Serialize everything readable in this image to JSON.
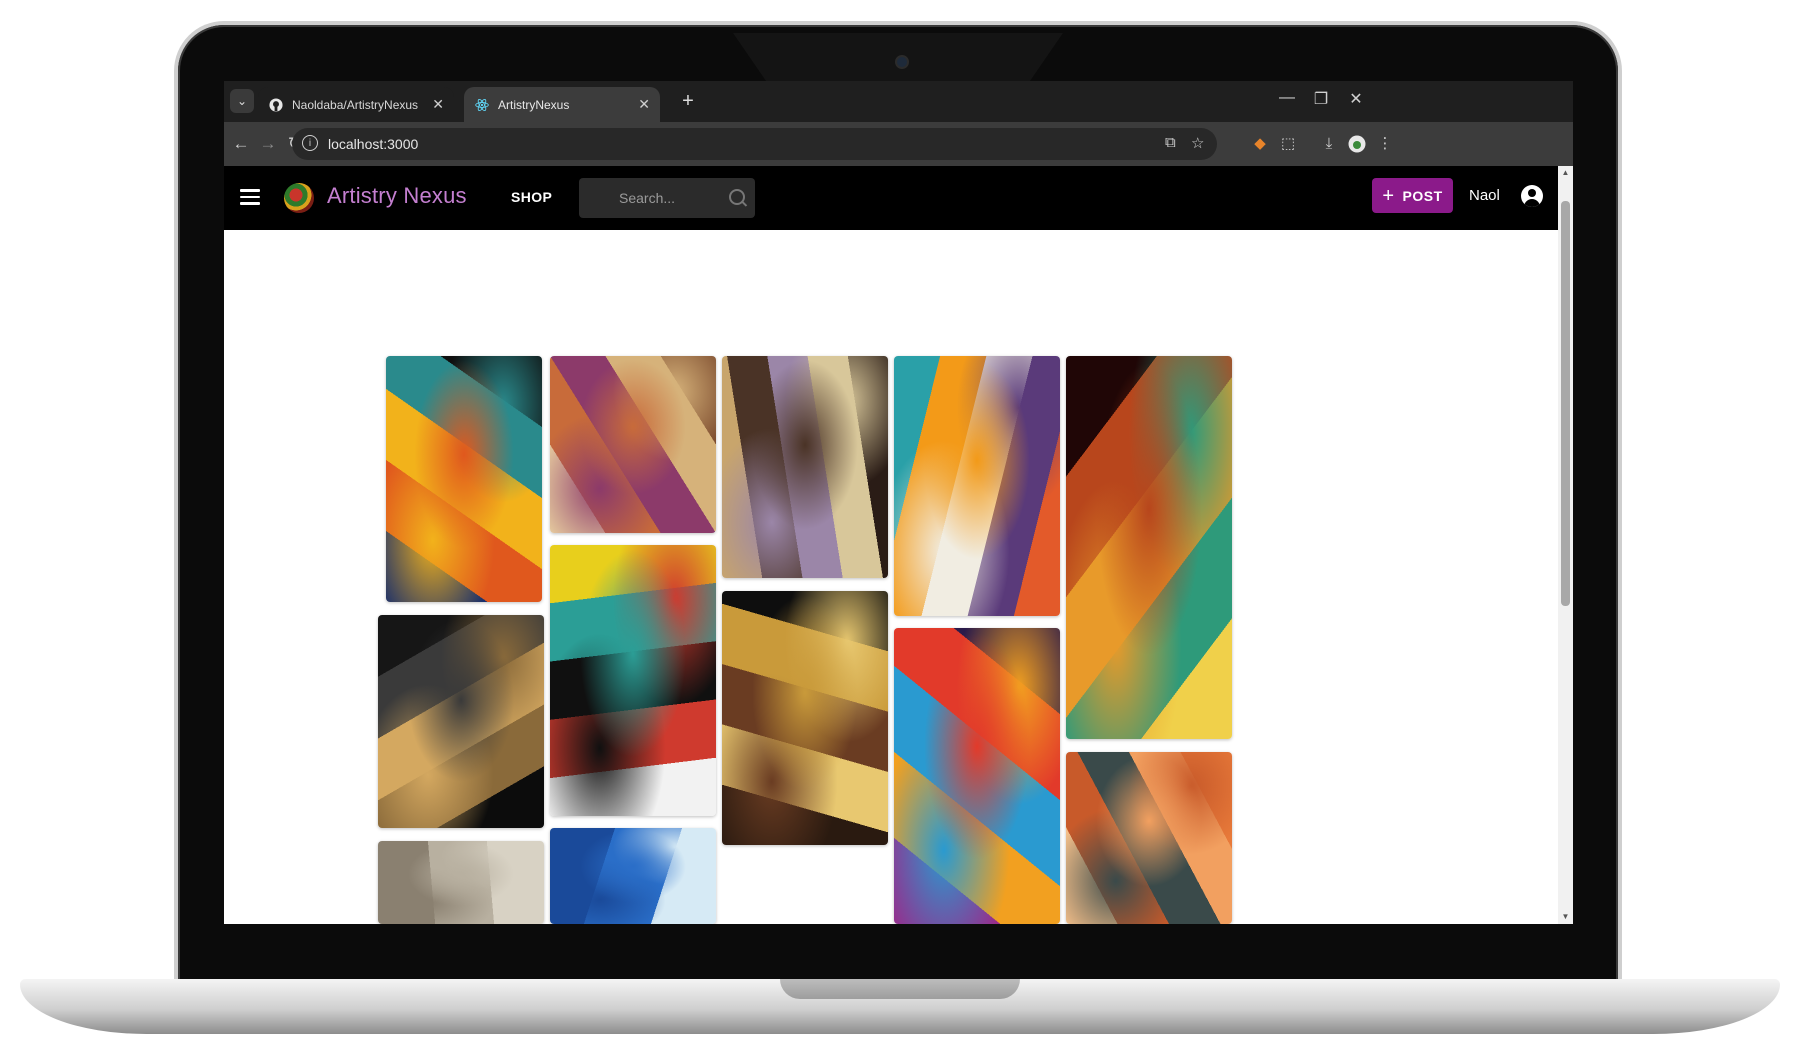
{
  "browser": {
    "tabs": [
      {
        "title": "Naoldaba/ArtistryNexus",
        "favicon": "github-icon",
        "active": false
      },
      {
        "title": "ArtistryNexus",
        "favicon": "react-icon",
        "active": true
      }
    ],
    "url": "localhost:3000"
  },
  "app": {
    "brand": "Artistry Nexus",
    "nav_shop": "SHOP",
    "search_placeholder": "Search...",
    "post_label": "POST",
    "user_name": "Naol",
    "accent_color": "#8b1a8a",
    "brand_color": "#c47fd0"
  },
  "gallery": [
    {
      "name": "abstract-faces-artwork",
      "colors": [
        "#1a2f6b",
        "#e0581d",
        "#f2b21b",
        "#2a8a8c",
        "#0f0f0f"
      ]
    },
    {
      "name": "musicians-painting",
      "colors": [
        "#e9cfa0",
        "#c86b3a",
        "#8c3a6a",
        "#d6b27a",
        "#7b4a2d"
      ]
    },
    {
      "name": "flower-crown-portrait",
      "colors": [
        "#c8a56c",
        "#4a3326",
        "#9b86a8",
        "#d8c79a",
        "#2a1c16"
      ]
    },
    {
      "name": "cubist-eye-face",
      "colors": [
        "#2aa0a8",
        "#f39a18",
        "#f1ede2",
        "#5a3a7a",
        "#e35a2a"
      ]
    },
    {
      "name": "tribal-mask",
      "colors": [
        "#200606",
        "#b8461c",
        "#e89a2a",
        "#2e9a7a",
        "#f0d04a"
      ]
    },
    {
      "name": "golden-fish-woodcut",
      "colors": [
        "#161616",
        "#3a3a3a",
        "#d4a860",
        "#8a6a3a",
        "#0c0c0c"
      ]
    },
    {
      "name": "teal-mask-face",
      "colors": [
        "#e8cf1c",
        "#2b9e96",
        "#101010",
        "#cf3a2e",
        "#f2f2f2"
      ]
    },
    {
      "name": "golden-headdress-portrait",
      "colors": [
        "#0e0e0e",
        "#c99a3a",
        "#6a3c22",
        "#e8c870",
        "#2a1a10"
      ]
    },
    {
      "name": "colorful-boy-portrait",
      "colors": [
        "#2a1a4a",
        "#e23a2a",
        "#2a9ad0",
        "#f2a020",
        "#9a2a8a"
      ]
    },
    {
      "name": "sculpture-orange",
      "colors": [
        "#e87a3a",
        "#f2a060",
        "#3a4a4a",
        "#c85a2a",
        "#f5c08a"
      ]
    },
    {
      "name": "pencil-portrait",
      "colors": [
        "#d8d2c4",
        "#b8b0a0",
        "#8a8070"
      ]
    },
    {
      "name": "blue-wrap-painting",
      "colors": [
        "#d6eaf5",
        "#2a6ec8",
        "#1a4a9a"
      ]
    }
  ]
}
